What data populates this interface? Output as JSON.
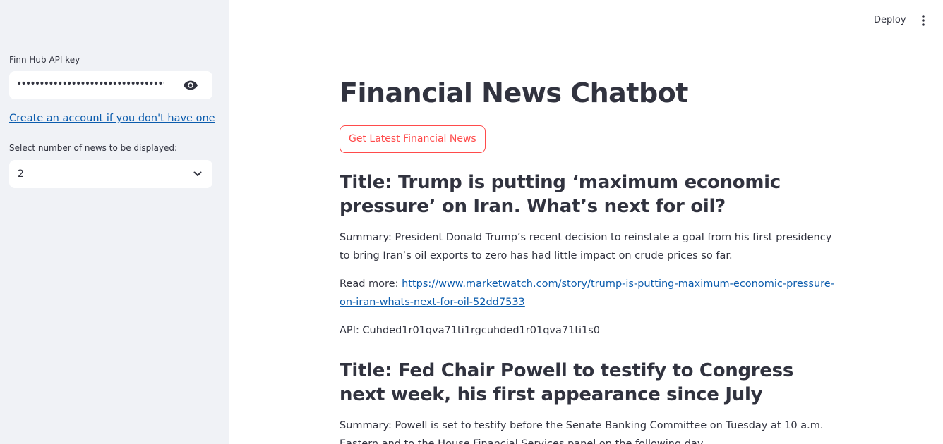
{
  "sidebar": {
    "api_key_label": "Finn Hub API key",
    "api_key_value": "••••••••••••••••••••••••••••••••••••••••",
    "create_account_link": "Create an account if you don't have one",
    "num_news_label": "Select number of news to be displayed:",
    "num_news_value": "2"
  },
  "header": {
    "deploy_label": "Deploy"
  },
  "main": {
    "title": "Financial News Chatbot",
    "button_label": "Get Latest Financial News",
    "articles": [
      {
        "title": "Title: Trump is putting ‘maximum economic pressure’ on Iran. What’s next for oil?",
        "summary": "Summary: President Donald Trump’s recent decision to reinstate a goal from his first presidency to bring Iran’s oil exports to zero has had little impact on crude prices so far.",
        "read_more_prefix": "Read more: ",
        "url": "https://www.marketwatch.com/story/trump-is-putting-maximum-economic-pressure-on-iran-whats-next-for-oil-52dd7533",
        "api": "API: Cuhded1r01qva71ti1rgcuhded1r01qva71ti1s0"
      },
      {
        "title": "Title: Fed Chair Powell to testify to Congress next week, his first appearance since July",
        "summary": "Summary: Powell is set to testify before the Senate Banking Committee on Tuesday at 10 a.m. Eastern and to the House Financial Services panel on the following day."
      }
    ]
  }
}
